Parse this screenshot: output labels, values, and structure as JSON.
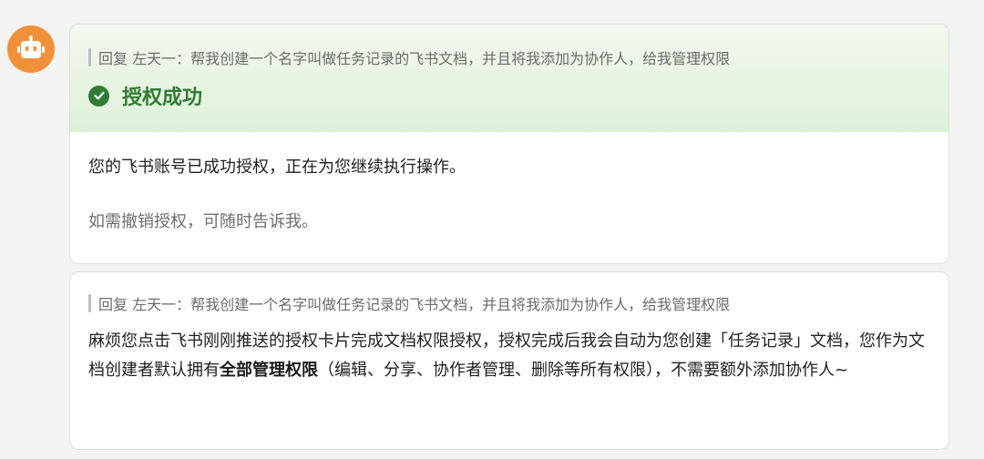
{
  "avatar": {
    "icon": "robot-icon",
    "color": "#f0913a"
  },
  "card1": {
    "reply_label": "回复 左天一：帮我创建一个名字叫做任务记录的飞书文档，并且将我添加为协作人，给我管理权限",
    "status_icon": "check-circle-icon",
    "status_text": "授权成功",
    "status_color": "#2f7d32",
    "message": "您的飞书账号已成功授权，正在为您继续执行操作。",
    "note": "如需撤销授权，可随时告诉我。"
  },
  "card2": {
    "reply_label": "回复 左天一：帮我创建一个名字叫做任务记录的飞书文档，并且将我添加为协作人，给我管理权限",
    "para_1": "麻烦您点击飞书刚刚推送的授权卡片完成文档权限授权，授权完成后我会自动为您创建「任务记录」文档，您作为文档创建者默认拥有",
    "para_bold": "全部管理权限",
    "para_2": "（编辑、分享、协作者管理、删除等所有权限），不需要额外添加协作人~"
  }
}
